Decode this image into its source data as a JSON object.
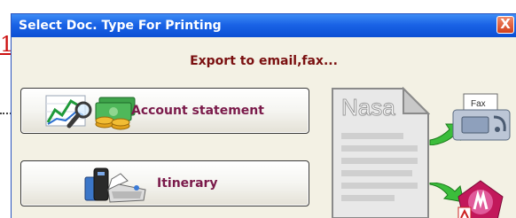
{
  "background": {
    "link_fragment": "1"
  },
  "dialog": {
    "title": "Select Doc. Type For Printing",
    "close_label": "X",
    "export_label": "Export to email,fax...",
    "buttons": {
      "account_statement": "Account statement",
      "itinerary": "Itinerary"
    },
    "doc_label": "Nasa",
    "fax_label": "Fax"
  }
}
